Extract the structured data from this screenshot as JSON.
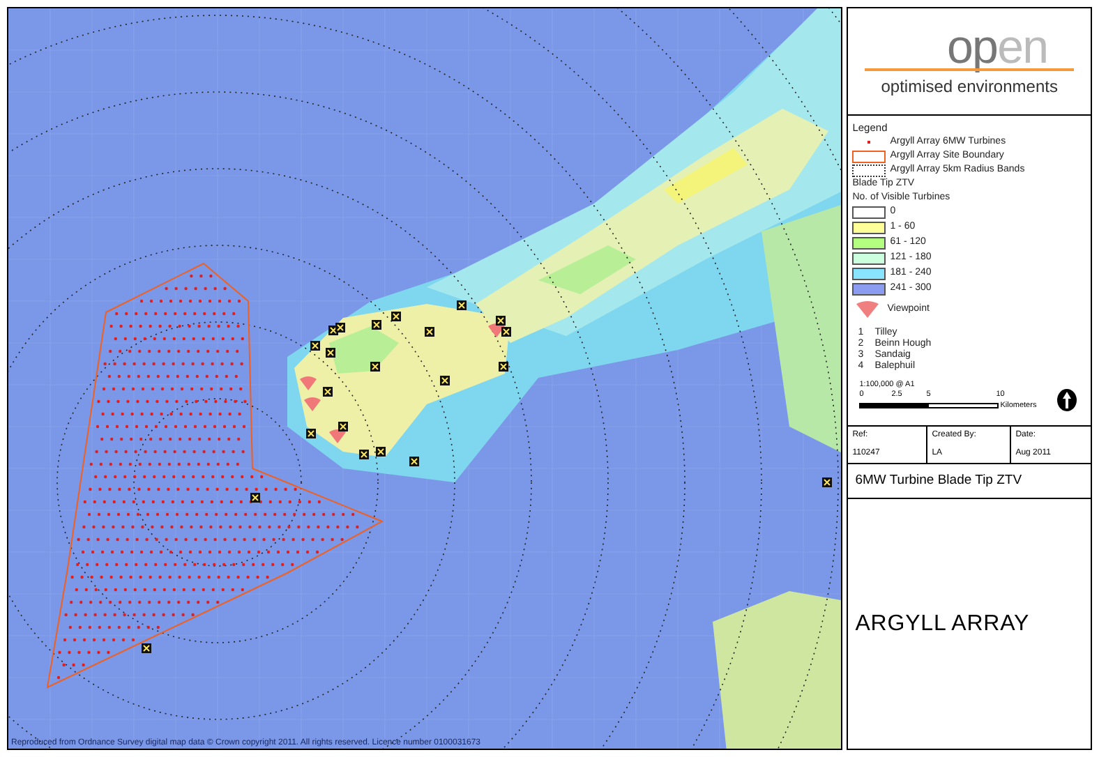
{
  "logo": {
    "word_dark": "op",
    "word_light": "en",
    "tagline": "optimised environments"
  },
  "legend": {
    "title": "Legend",
    "items": [
      {
        "kind": "dot",
        "label": "Argyll Array 6MW Turbines"
      },
      {
        "kind": "boundary",
        "label": "Argyll Array Site Boundary"
      },
      {
        "kind": "dotted",
        "label": "Argyll Array 5km Radius Bands"
      },
      {
        "kind": "heading",
        "label": "Blade Tip ZTV"
      },
      {
        "kind": "heading",
        "label": "No. of Visible Turbines"
      },
      {
        "kind": "swatch",
        "label": "0",
        "color": "#ffffff"
      },
      {
        "kind": "swatch",
        "label": "1 - 60",
        "color": "#ffff99"
      },
      {
        "kind": "swatch",
        "label": "61 - 120",
        "color": "#b3ff80"
      },
      {
        "kind": "swatch",
        "label": "121 - 180",
        "color": "#ccffdd"
      },
      {
        "kind": "swatch",
        "label": "181 - 240",
        "color": "#88e4ff"
      },
      {
        "kind": "swatch",
        "label": "241 - 300",
        "color": "#8c9cf0"
      },
      {
        "kind": "viewpoint",
        "label": "Viewpoint"
      }
    ],
    "viewpoints": [
      {
        "number": "1",
        "name": "Tilley"
      },
      {
        "number": "2",
        "name": "Beinn Hough"
      },
      {
        "number": "3",
        "name": "Sandaig"
      },
      {
        "number": "4",
        "name": "Balephuil"
      }
    ]
  },
  "scale": {
    "ratio": "1:100,000 @ A1",
    "ticks": [
      "0",
      "2.5",
      "5",
      "10"
    ],
    "unit": "Kilometers"
  },
  "info": [
    {
      "label": "Ref:",
      "value": "110247"
    },
    {
      "label": "Created By:",
      "value": "LA"
    },
    {
      "label": "Date:",
      "value": "Aug 2011"
    }
  ],
  "subtitle": "6MW Turbine Blade Tip ZTV",
  "title": "ARGYLL ARRAY",
  "credit": "Reproduced from Ordnance Survey digital map data © Crown copyright 2011. All rights reserved. Licence number 0100031673"
}
